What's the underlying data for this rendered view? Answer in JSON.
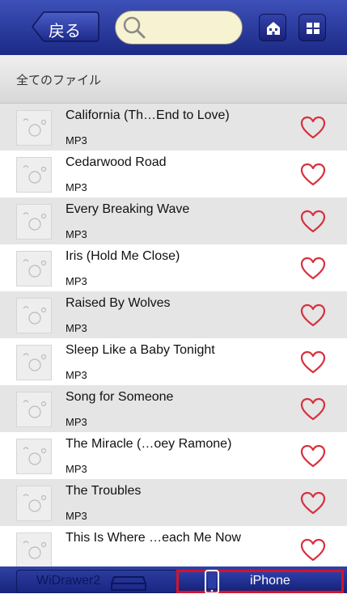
{
  "header": {
    "back_label": "戻る",
    "search_placeholder": "",
    "home_button": "home-icon",
    "grid_button": "grid-icon"
  },
  "breadcrumb": {
    "label": "全てのファイル"
  },
  "files": [
    {
      "title": "California (Th…End to Love)",
      "type": "MP3"
    },
    {
      "title": "Cedarwood Road",
      "type": "MP3"
    },
    {
      "title": "Every Breaking Wave",
      "type": "MP3"
    },
    {
      "title": "Iris (Hold Me Close)",
      "type": "MP3"
    },
    {
      "title": "Raised By Wolves",
      "type": "MP3"
    },
    {
      "title": "Sleep Like a Baby Tonight",
      "type": "MP3"
    },
    {
      "title": "Song for Someone",
      "type": "MP3"
    },
    {
      "title": "The Miracle (…oey Ramone)",
      "type": "MP3"
    },
    {
      "title": "The Troubles",
      "type": "MP3"
    },
    {
      "title": "This Is Where …each Me Now",
      "type": ""
    }
  ],
  "bottom_tabs": {
    "widrawer_label": "WiDrawer2",
    "iphone_label": "iPhone"
  },
  "colors": {
    "heart": "#d8303e",
    "selected_tab_border": "#d4142a",
    "bar": "#2536a0"
  }
}
